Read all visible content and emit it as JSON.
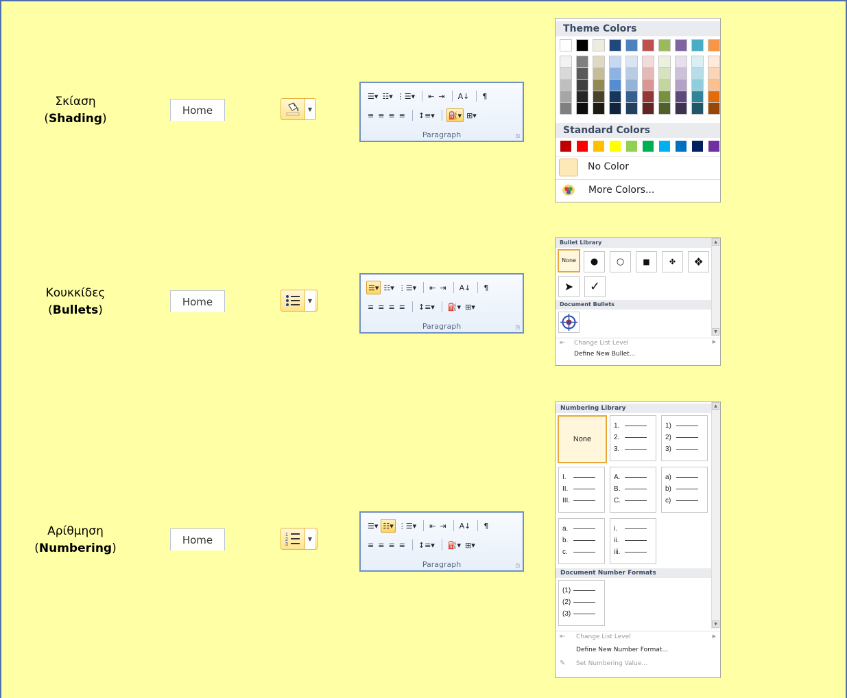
{
  "rows": [
    {
      "caption_greek": "Σκίαση",
      "caption_english": "Shading"
    },
    {
      "caption_greek": "Κουκκίδες",
      "caption_english": "Bullets"
    },
    {
      "caption_greek": "Αρίθμηση",
      "caption_english": "Numbering"
    }
  ],
  "home_tab_label": "Home",
  "paragraph_group_label": "Paragraph",
  "shading_menu": {
    "theme_heading": "Theme Colors",
    "theme_colors": [
      [
        "#ffffff",
        "#f2f2f2",
        "#d9d9d9",
        "#bfbfbf",
        "#a6a6a6",
        "#808080"
      ],
      [
        "#000000",
        "#7f7f7f",
        "#595959",
        "#3f3f3f",
        "#262626",
        "#0d0d0d"
      ],
      [
        "#eeece1",
        "#ddd9c3",
        "#c4bd97",
        "#938953",
        "#494429",
        "#1d1b10"
      ],
      [
        "#1f497d",
        "#c6d9f0",
        "#8db3e2",
        "#548dd4",
        "#17365d",
        "#0f243e"
      ],
      [
        "#4f81bd",
        "#dbe5f1",
        "#b8cce4",
        "#95b3d7",
        "#366092",
        "#244061"
      ],
      [
        "#c0504d",
        "#f2dcdb",
        "#e5b9b7",
        "#d99694",
        "#953734",
        "#632423"
      ],
      [
        "#9bbb59",
        "#ebf1dd",
        "#d7e3bc",
        "#c3d69b",
        "#76923c",
        "#4f6128"
      ],
      [
        "#8064a2",
        "#e5e0ec",
        "#ccc1d9",
        "#b2a2c7",
        "#5f497a",
        "#3f3151"
      ],
      [
        "#4bacc6",
        "#dbeef3",
        "#b7dde8",
        "#92cddc",
        "#31859b",
        "#205867"
      ],
      [
        "#f79646",
        "#fdeada",
        "#fbd5b5",
        "#fac08f",
        "#e36c09",
        "#974806"
      ]
    ],
    "standard_heading": "Standard Colors",
    "standard_colors": [
      "#c00000",
      "#ff0000",
      "#ffc000",
      "#ffff00",
      "#92d050",
      "#00b050",
      "#00b0f0",
      "#0070c0",
      "#002060",
      "#7030a0"
    ],
    "no_color_label": "No Color",
    "more_colors_label": "More Colors..."
  },
  "bullets_menu": {
    "library_heading": "Bullet Library",
    "none_label": "None",
    "bullet_glyphs": [
      "●",
      "○",
      "■",
      "✤",
      "❖",
      "➤",
      "✓"
    ],
    "document_heading": "Document Bullets",
    "change_level_label": "Change List Level",
    "define_label": "Define New Bullet..."
  },
  "numbering_menu": {
    "library_heading": "Numbering Library",
    "none_label": "None",
    "formats": [
      [
        "1.",
        "2.",
        "3."
      ],
      [
        "1)",
        "2)",
        "3)"
      ],
      [
        "I.",
        "II.",
        "III."
      ],
      [
        "A.",
        "B.",
        "C."
      ],
      [
        "a)",
        "b)",
        "c)"
      ],
      [
        "a.",
        "b.",
        "c."
      ],
      [
        "i.",
        "ii.",
        "iii."
      ]
    ],
    "document_heading": "Document Number Formats",
    "document_formats": [
      [
        "(1)",
        "(2)",
        "(3)"
      ]
    ],
    "change_level_label": "Change List Level",
    "define_label": "Define New Number Format...",
    "set_value_label": "Set Numbering Value..."
  }
}
